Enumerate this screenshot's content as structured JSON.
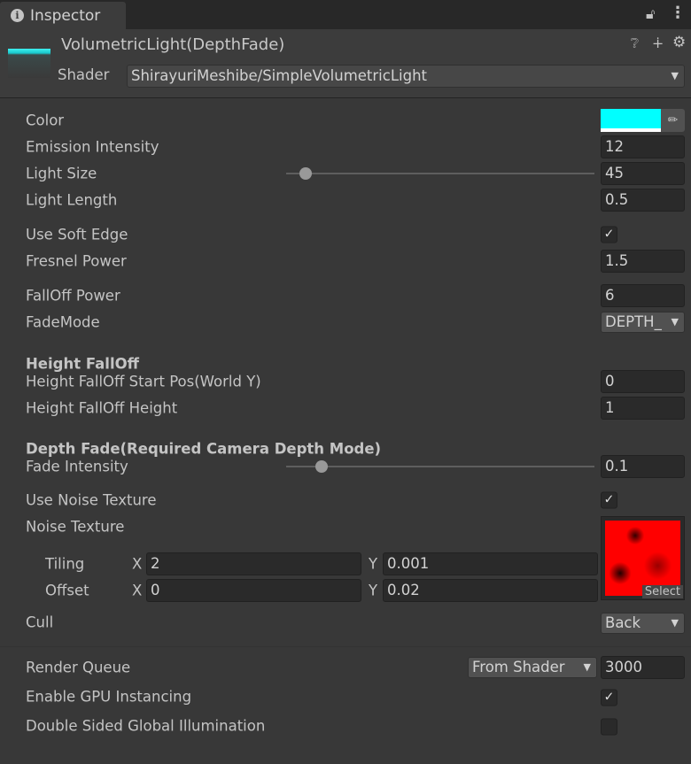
{
  "tab": {
    "title": "Inspector"
  },
  "header": {
    "material_name": "VolumetricLight(DepthFade)",
    "shader_label": "Shader",
    "shader_value": "ShirayuriMeshibe/SimpleVolumetricLight"
  },
  "properties": {
    "color": {
      "label": "Color",
      "value": "#00ffff"
    },
    "emission": {
      "label": "Emission Intensity",
      "value": "12"
    },
    "light_size": {
      "label": "Light Size",
      "value": "45",
      "slider_fraction": 0.06
    },
    "light_length": {
      "label": "Light Length",
      "value": "0.5"
    },
    "soft_edge": {
      "label": "Use Soft Edge",
      "checked": true
    },
    "fresnel": {
      "label": "Fresnel Power",
      "value": "1.5"
    },
    "falloff": {
      "label": "FallOff Power",
      "value": "6"
    },
    "fade_mode": {
      "label": "FadeMode",
      "value": "DEPTH_"
    },
    "height_header": "Height FallOff",
    "height_start": {
      "label": "Height FallOff Start Pos(World Y)",
      "value": "0"
    },
    "height_height": {
      "label": "Height FallOff Height",
      "value": "1"
    },
    "depth_header": "Depth Fade(Required Camera Depth Mode)",
    "fade_intensity": {
      "label": "Fade Intensity",
      "value": "0.1",
      "slider_fraction": 0.11
    },
    "use_noise": {
      "label": "Use Noise Texture",
      "checked": true
    },
    "noise_texture": {
      "label": "Noise Texture",
      "select_label": "Select"
    },
    "tiling": {
      "label": "Tiling",
      "x_label": "X",
      "x": "2",
      "y_label": "Y",
      "y": "0.001"
    },
    "offset": {
      "label": "Offset",
      "x_label": "X",
      "x": "0",
      "y_label": "Y",
      "y": "0.02"
    },
    "cull": {
      "label": "Cull",
      "value": "Back"
    },
    "render_queue": {
      "label": "Render Queue",
      "mode": "From Shader",
      "value": "3000"
    },
    "gpu_instancing": {
      "label": "Enable GPU Instancing",
      "checked": true
    },
    "dsgi": {
      "label": "Double Sided Global Illumination",
      "checked": false
    }
  }
}
